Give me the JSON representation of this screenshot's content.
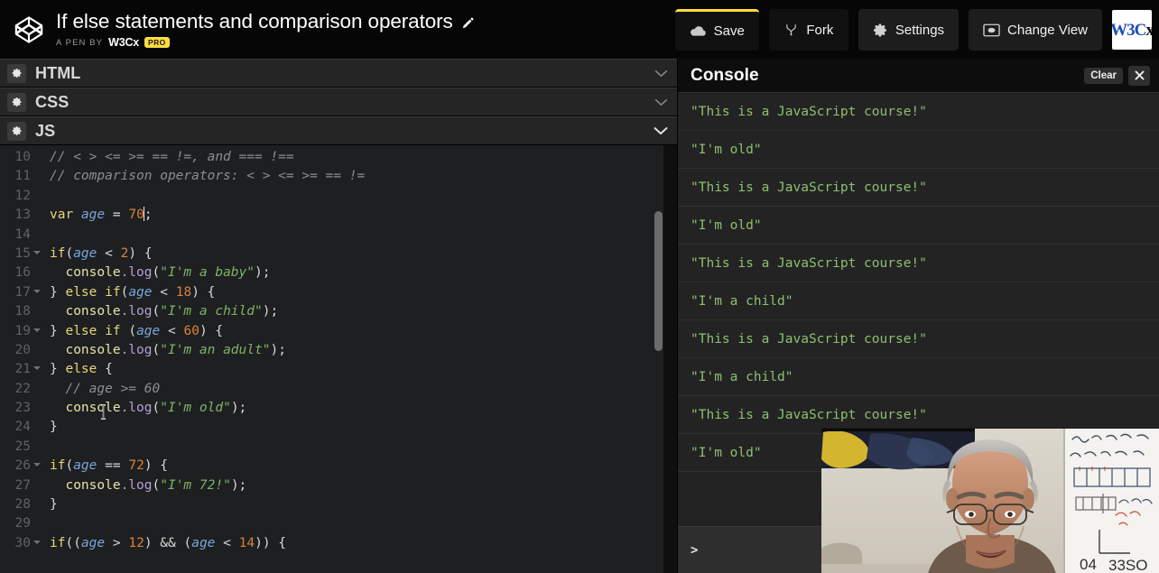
{
  "topbar": {
    "logo_icon": "codepen-logo-icon",
    "pen_title": "If else statements and comparison operators",
    "edit_icon": "pencil-edit-icon",
    "byline_label": "A PEN BY",
    "byline_user": "W3Cx",
    "pro_badge": "PRO",
    "buttons": [
      {
        "label": "Save",
        "icon": "cloud-save-icon"
      },
      {
        "label": "Fork",
        "icon": "fork-icon"
      },
      {
        "label": "Settings",
        "icon": "gear-icon"
      },
      {
        "label": "Change View",
        "icon": "change-view-icon"
      }
    ],
    "account_logo": {
      "blue": "W3C",
      "black": "x"
    },
    "accent_color": "#ffdd40"
  },
  "editors": [
    {
      "title": "HTML",
      "settings_icon": "gear-icon",
      "collapse_icon": "chevron-down-icon"
    },
    {
      "title": "CSS",
      "settings_icon": "gear-icon",
      "collapse_icon": "chevron-down-icon"
    },
    {
      "title": "JS",
      "settings_icon": "gear-icon",
      "collapse_icon": "chevron-down-icon"
    }
  ],
  "code": {
    "language": "JS",
    "first_line_number": 10,
    "cursor_line": 13,
    "lines": [
      {
        "n": 10,
        "fold": false,
        "text": "// < > <= >= == !=, and === !=="
      },
      {
        "n": 11,
        "fold": false,
        "text": "// comparison operators: < > <= >= == !="
      },
      {
        "n": 12,
        "fold": false,
        "text": ""
      },
      {
        "n": 13,
        "fold": false,
        "text": "var age = 70;"
      },
      {
        "n": 14,
        "fold": false,
        "text": ""
      },
      {
        "n": 15,
        "fold": true,
        "text": "if(age < 2) {"
      },
      {
        "n": 16,
        "fold": false,
        "text": "  console.log(\"I'm a baby\");"
      },
      {
        "n": 17,
        "fold": true,
        "text": "} else if(age < 18) {"
      },
      {
        "n": 18,
        "fold": false,
        "text": "  console.log(\"I'm a child\");"
      },
      {
        "n": 19,
        "fold": true,
        "text": "} else if (age < 60) {"
      },
      {
        "n": 20,
        "fold": false,
        "text": "  console.log(\"I'm an adult\");"
      },
      {
        "n": 21,
        "fold": true,
        "text": "} else {"
      },
      {
        "n": 22,
        "fold": false,
        "text": "  // age >= 60"
      },
      {
        "n": 23,
        "fold": false,
        "text": "  console.log(\"I'm old\");"
      },
      {
        "n": 24,
        "fold": false,
        "text": "}"
      },
      {
        "n": 25,
        "fold": false,
        "text": ""
      },
      {
        "n": 26,
        "fold": true,
        "text": "if(age == 72) {"
      },
      {
        "n": 27,
        "fold": false,
        "text": "  console.log(\"I'm 72!\");"
      },
      {
        "n": 28,
        "fold": false,
        "text": "}"
      },
      {
        "n": 29,
        "fold": false,
        "text": ""
      },
      {
        "n": 30,
        "fold": true,
        "text": "if((age > 12) && (age < 14)) {"
      }
    ]
  },
  "console": {
    "title": "Console",
    "clear_label": "Clear",
    "close_icon": "close-icon",
    "prompt": ">",
    "entries": [
      "\"This is a JavaScript course!\"",
      "\"I'm old\"",
      "\"This is a JavaScript course!\"",
      "\"I'm old\"",
      "\"This is a JavaScript course!\"",
      "\"I'm a child\"",
      "\"This is a JavaScript course!\"",
      "\"I'm a child\"",
      "\"This is a JavaScript course!\"",
      "\"I'm old\""
    ]
  },
  "webcam": {
    "name": "presenter-webcam-overlay",
    "description": "Video of a presenter in front of a whiteboard"
  }
}
